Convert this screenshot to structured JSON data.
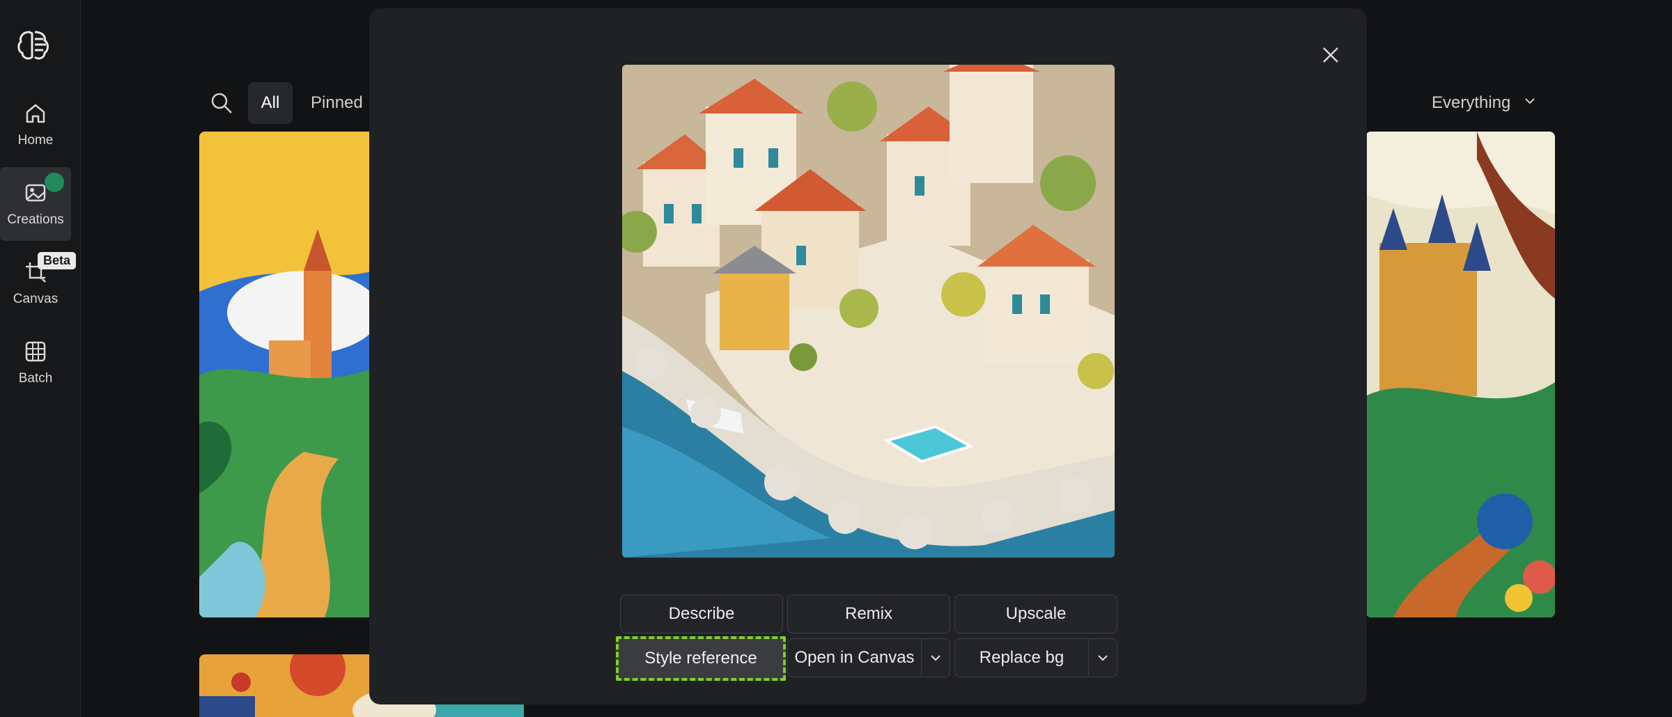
{
  "sidebar": {
    "items": [
      {
        "label": "Home",
        "icon": "home-icon"
      },
      {
        "label": "Creations",
        "icon": "image-icon",
        "active": true
      },
      {
        "label": "Canvas",
        "icon": "crop-icon",
        "badge": "Beta"
      },
      {
        "label": "Batch",
        "icon": "grid-image-icon"
      }
    ]
  },
  "filters": {
    "all": "All",
    "pinned": "Pinned",
    "everything": "Everything"
  },
  "modal": {
    "buttons": {
      "describe": "Describe",
      "remix": "Remix",
      "upscale": "Upscale",
      "style_reference": "Style reference",
      "open_in_canvas": "Open in Canvas",
      "replace_bg": "Replace bg"
    }
  },
  "colors": {
    "accent_outline": "#7ed321",
    "badge_green": "#1f8a5a"
  }
}
